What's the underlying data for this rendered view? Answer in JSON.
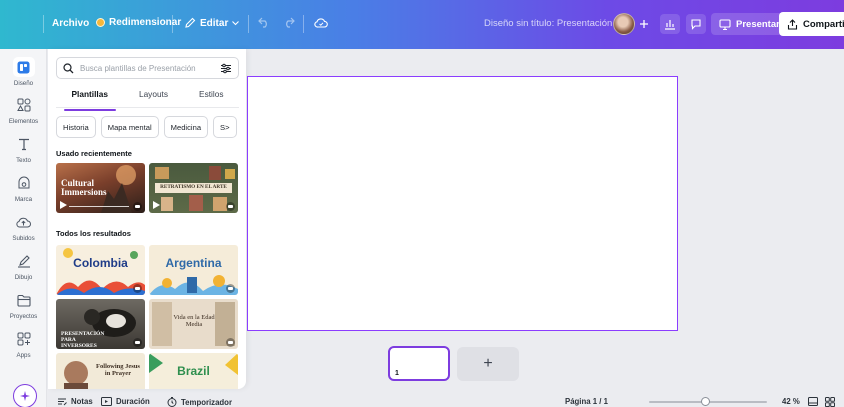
{
  "topbar": {
    "file_label": "Archivo",
    "resize_label": "Redimensionar",
    "edit_label": "Editar",
    "doc_title": "Diseño sin título: Presentación",
    "present_label": "Presentar",
    "share_label": "Compartir"
  },
  "rail": {
    "items": [
      {
        "label": "Diseño",
        "icon": "design-icon"
      },
      {
        "label": "Elementos",
        "icon": "elements-icon"
      },
      {
        "label": "Texto",
        "icon": "text-icon"
      },
      {
        "label": "Marca",
        "icon": "brand-icon"
      },
      {
        "label": "Subidos",
        "icon": "uploads-icon"
      },
      {
        "label": "Dibujo",
        "icon": "draw-icon"
      },
      {
        "label": "Proyectos",
        "icon": "projects-icon"
      },
      {
        "label": "Apps",
        "icon": "apps-icon"
      }
    ]
  },
  "panel": {
    "search_placeholder": "Busca plantillas de Presentación",
    "tabs": [
      "Plantillas",
      "Layouts",
      "Estilos"
    ],
    "chips": [
      "Historia",
      "Mapa mental",
      "Medicina",
      "S>"
    ],
    "recent_title": "Usado recientemente",
    "results_title": "Todos los resultados",
    "thumbs": [
      {
        "text": "Cultural Immersions"
      },
      {
        "text": "RETRATISMO EN EL ARTE"
      },
      {
        "text": "Colombia"
      },
      {
        "text": "Argentina"
      },
      {
        "text": "PRESENTACIÓN PARA INVERSORES"
      },
      {
        "text": "Vida en la Edad Media"
      },
      {
        "text": "Following Jesus in Prayer"
      },
      {
        "text": "Brazil"
      }
    ]
  },
  "canvas": {
    "page_number": "1",
    "add_page": "+"
  },
  "footer": {
    "notes": "Notas",
    "duration": "Duración",
    "timer": "Temporizador",
    "page_indicator": "Página 1 / 1",
    "zoom": "42 %"
  },
  "colors": {
    "accent": "#7d3cdf",
    "gradient_start": "#2fb8cf",
    "gradient_end": "#7d3cdf"
  }
}
